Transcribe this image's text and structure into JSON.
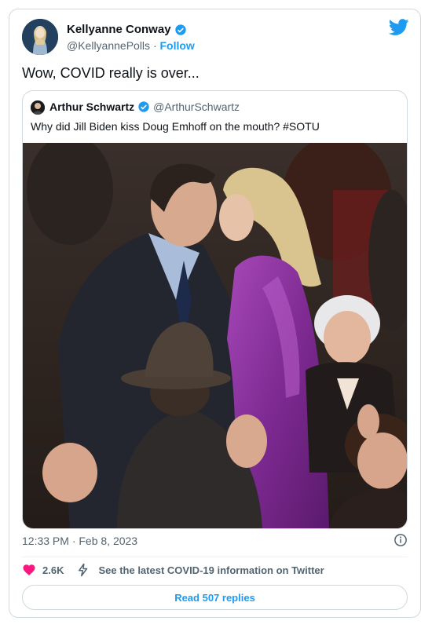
{
  "tweet": {
    "author_name": "Kellyanne Conway",
    "author_handle": "@KellyannePolls",
    "separator": "·",
    "follow_label": "Follow",
    "text": "Wow, COVID really is over...",
    "timestamp": "12:33 PM · Feb 8, 2023",
    "likes_count": "2.6K",
    "covid_info_label": "See the latest COVID-19 information on Twitter",
    "replies_button_label": "Read 507 replies"
  },
  "quoted_tweet": {
    "author_name": "Arthur Schwartz",
    "author_handle": "@ArthurSchwartz",
    "text": "Why did Jill Biden kiss Doug Emhoff on the mouth? #SOTU"
  },
  "colors": {
    "accent": "#1d9bf0",
    "heart": "#f91880",
    "secondary_text": "#536471",
    "border": "#cfd9de"
  },
  "icons": [
    "verified-badge-icon",
    "twitter-bird-icon",
    "info-icon",
    "heart-icon",
    "lightning-bolt-icon"
  ]
}
